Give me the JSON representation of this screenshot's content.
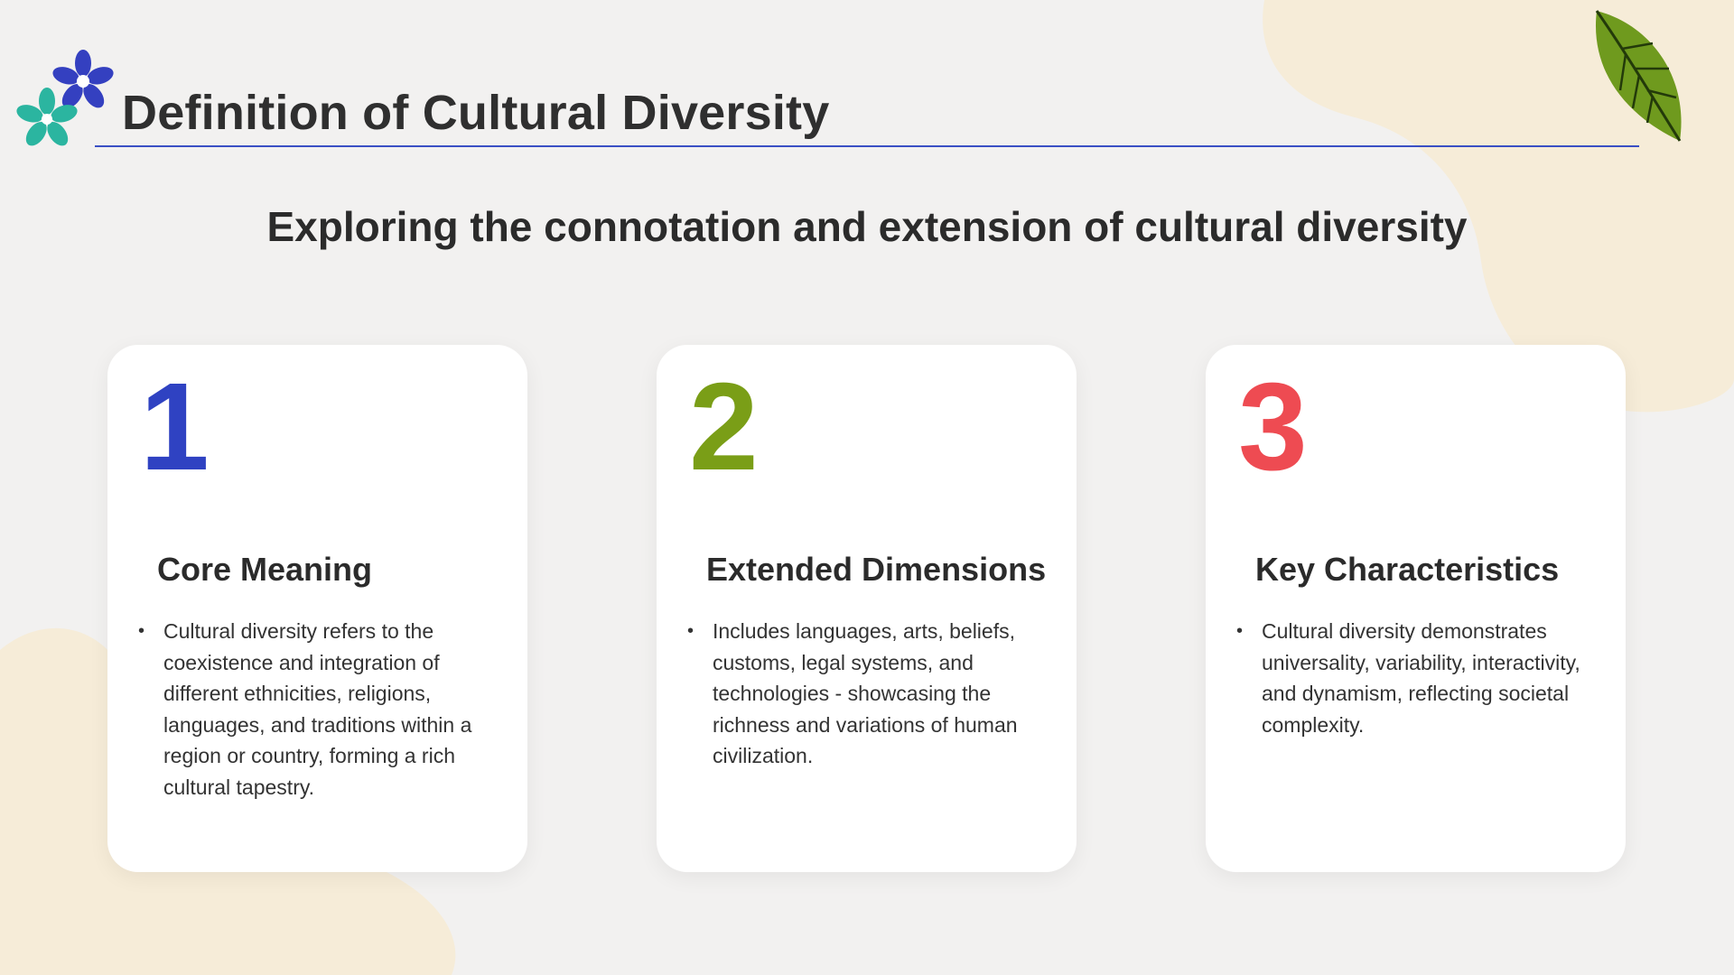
{
  "title": "Definition of Cultural Diversity",
  "subtitle": "Exploring the connotation and extension of cultural diversity",
  "colors": {
    "accent_blue": "#2f42c2",
    "accent_green": "#7a9e17",
    "accent_red": "#ee4b52",
    "rule": "#3a4fc4",
    "blob": "#f6ecd8"
  },
  "decorations": {
    "top_left": "flower-cluster-icon",
    "top_right": "green-leaf-icon"
  },
  "cards": [
    {
      "number": "1",
      "heading": "Core Meaning",
      "bullet": "Cultural diversity refers to the coexistence and integration of different ethnicities, religions, languages, and traditions within a region or country, forming a rich cultural tapestry."
    },
    {
      "number": "2",
      "heading": "Extended Dimensions",
      "bullet": "Includes languages, arts, beliefs, customs, legal systems, and technologies - showcasing the richness and variations of human civilization."
    },
    {
      "number": "3",
      "heading": "Key Characteristics",
      "bullet": "Cultural diversity demonstrates universality, variability, interactivity, and dynamism, reflecting societal complexity."
    }
  ]
}
